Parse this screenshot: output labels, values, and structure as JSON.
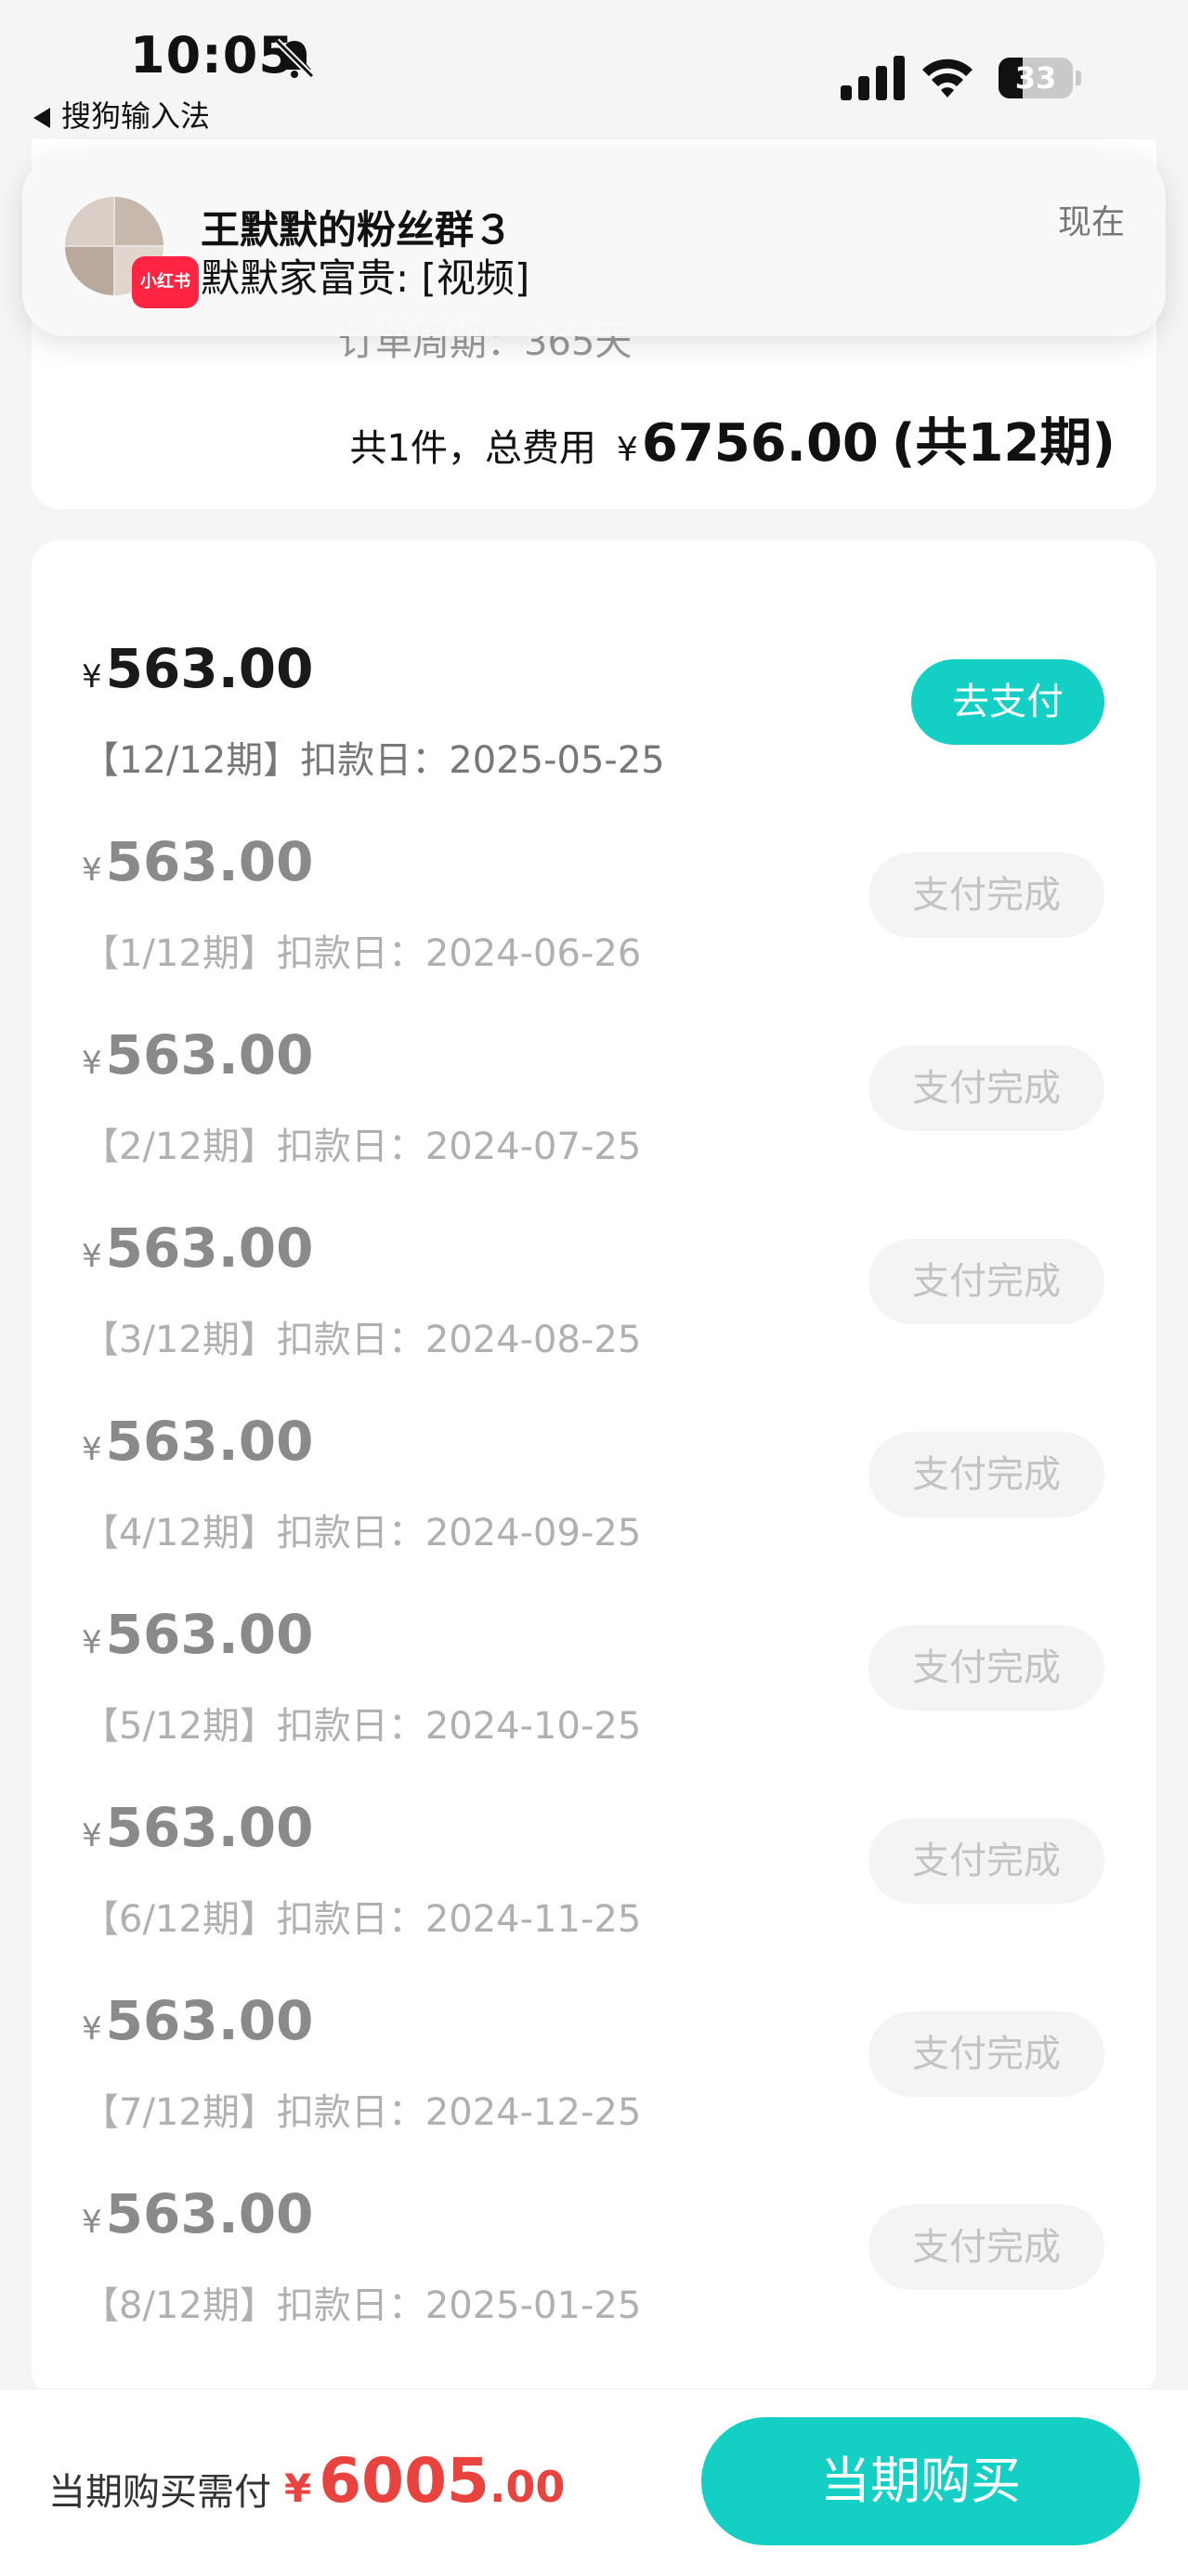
{
  "status_bar": {
    "time": "10:05",
    "back_app": "搜狗输入法",
    "battery": "33",
    "battery_level": 0.33
  },
  "notification": {
    "badge": "小红书",
    "title": "王默默的粉丝群３",
    "body": "默默家富贵: [视频]",
    "time": "现在"
  },
  "summary": {
    "cycle_text": "订单周期：365天",
    "total_label": "共1件，总费用",
    "currency": "¥",
    "total_amount": "6756.00",
    "periods": "(共12期)"
  },
  "installments": [
    {
      "yen": "¥",
      "amount": "563.00",
      "desc": "【12/12期】扣款日：2025-05-25",
      "action": "去支付",
      "status": "active"
    },
    {
      "yen": "¥",
      "amount": "563.00",
      "desc": "【1/12期】扣款日：2024-06-26",
      "action": "支付完成",
      "status": "done"
    },
    {
      "yen": "¥",
      "amount": "563.00",
      "desc": "【2/12期】扣款日：2024-07-25",
      "action": "支付完成",
      "status": "done"
    },
    {
      "yen": "¥",
      "amount": "563.00",
      "desc": "【3/12期】扣款日：2024-08-25",
      "action": "支付完成",
      "status": "done"
    },
    {
      "yen": "¥",
      "amount": "563.00",
      "desc": "【4/12期】扣款日：2024-09-25",
      "action": "支付完成",
      "status": "done"
    },
    {
      "yen": "¥",
      "amount": "563.00",
      "desc": "【5/12期】扣款日：2024-10-25",
      "action": "支付完成",
      "status": "done"
    },
    {
      "yen": "¥",
      "amount": "563.00",
      "desc": "【6/12期】扣款日：2024-11-25",
      "action": "支付完成",
      "status": "done"
    },
    {
      "yen": "¥",
      "amount": "563.00",
      "desc": "【7/12期】扣款日：2024-12-25",
      "action": "支付完成",
      "status": "done"
    },
    {
      "yen": "¥",
      "amount": "563.00",
      "desc": "【8/12期】扣款日：2025-01-25",
      "action": "支付完成",
      "status": "done"
    }
  ],
  "bottom_bar": {
    "label": "当期购买需付",
    "currency": "¥",
    "amount_int": "6005",
    "amount_dec": ".00",
    "buy_button": "当期购买"
  },
  "colors": {
    "accent": "#14d0c4",
    "price_red": "#e8433f",
    "done_text": "#c3c3c3",
    "badge_red": "#ff2442"
  }
}
